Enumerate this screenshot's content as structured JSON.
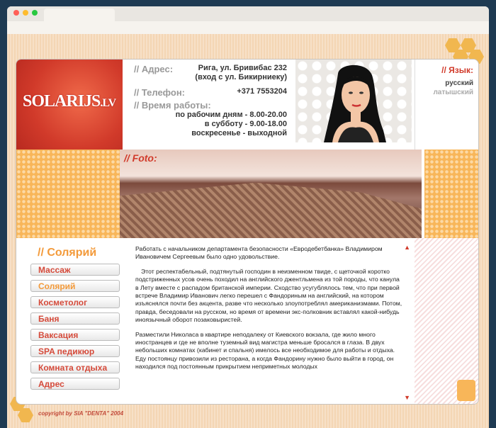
{
  "logo": {
    "text": "SOLARIJS",
    "suffix": ".LV"
  },
  "contact": {
    "address_label": "// Адрес:",
    "address_line1": "Рига, ул. Бривибас 232",
    "address_line2": "(вход с ул. Бикирниеку)",
    "phone_label": "// Телефон:",
    "phone": "+371 7553204",
    "hours_label": "// Время работы:",
    "hours_weekdays": "по рабочим дням - 8.00-20.00",
    "hours_saturday": "в субботу - 9.00-18.00",
    "hours_sunday": "воскресенье - выходной"
  },
  "lang": {
    "label": "// Язык:",
    "items": [
      "русский",
      "латышский"
    ]
  },
  "photo": {
    "label": "// Foto:"
  },
  "nav": {
    "title": "// Солярий",
    "items": [
      "Массаж",
      "Солярий",
      "Косметолог",
      "Баня",
      "Ваксация",
      "SPA педикюр",
      "Комната отдыха",
      "Адрес"
    ],
    "active_index": 1
  },
  "content": {
    "paragraphs": [
      "Работать с начальником департамента безопасности «Евродебетбанка» Владимиром Ивановичем Сергеевым было одно удовольствие.",
      "Этот респектабельный, подтянутый господин в неизменном твиде, с щеточкой коротко подстриженных усов очень походил на английского джентльмена из той породы, что канула в Лету вместе с распадом британской империи. Сходство усугублялось тем, что при первой встрече Владимир Иванович легко перешел с Фандориным на английский, на котором изъяснялся почти без акцента, разве что несколько злоупотреблял американизмами. Потом, правда, беседовали на русском, но время от времени экс-полковник вставлял какой-нибудь иноязычный оборот позаковыристей.",
      "Разместили Николаса в квартире неподалеку от Киевского вокзала, где жило много иностранцев и где не вполне туземный вид магистра меньше бросался в глаза. В двух небольших комнатах (кабинет и спальня) имелось все необходимое для работы и отдыха. Еду постоянцу привозили из ресторана, а когда Фандорину нужно было выйти в город, он находился под постоянным прикрытием неприметных молодых"
    ]
  },
  "footer": {
    "copyright": "copyright by SIA \"DENTA\" 2004"
  },
  "colors": {
    "accent_red": "#d13a2a",
    "accent_orange": "#f39a3a",
    "page_bg": "#1e3a52"
  }
}
